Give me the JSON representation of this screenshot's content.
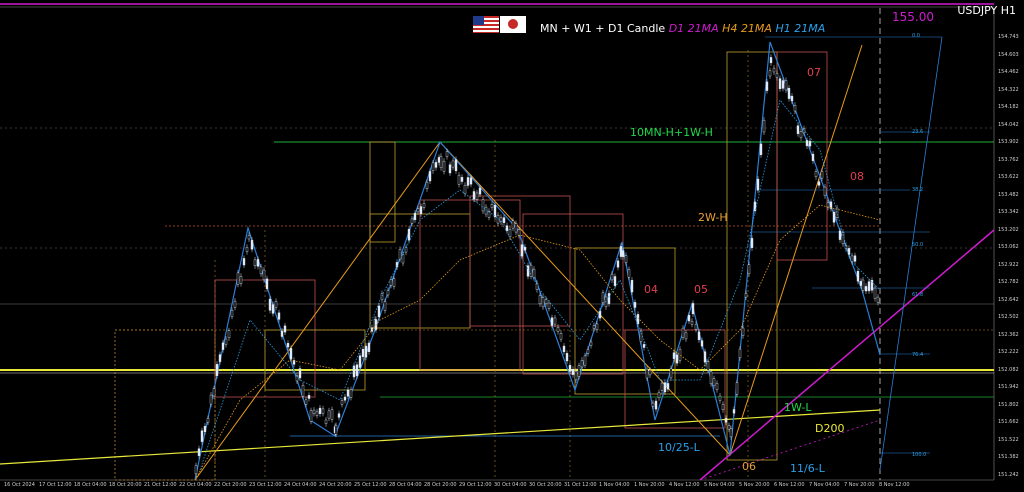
{
  "header": {
    "prefix": "MN + W1 + D1 Candle",
    "d1_ma": "D1 21MA",
    "h4_ma": "H4 21MA",
    "h1_ma": "H1 21MA"
  },
  "colors": {
    "d1_ma": "#d01bd0",
    "h4_ma": "#e89a1c",
    "h1_ma": "#2aa0e8",
    "candle": "#dfe9f7",
    "wave": "#2a7fd8",
    "level_green": "#1fae3a",
    "yellow_line": "#e8e83a",
    "magenta_line": "#d01bd0"
  },
  "symbol": "USDJPY H1",
  "price_level": "155.00",
  "labels": {
    "level_mn": "10MN-H+1W-H",
    "level_2w": "2W-H",
    "wave_04": "04",
    "wave_05": "05",
    "wave_06": "06",
    "wave_07": "07",
    "wave_08": "08",
    "level_1w": "1W-L",
    "d200": "D200",
    "low_1025": "10/25-L",
    "low_116": "11/6-L"
  },
  "fib_labels": [
    "0.0",
    "23.6",
    "38.2",
    "50.0",
    "61.8",
    "76.4",
    "100.0"
  ],
  "y_axis": [
    "154.743",
    "154.603",
    "154.462",
    "154.322",
    "154.182",
    "154.042",
    "153.902",
    "153.762",
    "153.622",
    "153.482",
    "153.342",
    "153.202",
    "153.062",
    "152.922",
    "152.782",
    "152.642",
    "152.502",
    "152.362",
    "152.222",
    "152.082",
    "151.942",
    "151.802",
    "151.662",
    "151.522",
    "151.382",
    "151.242"
  ],
  "x_axis": [
    "16 Oct 2024",
    "17 Oct 12:00",
    "18 Oct 04:00",
    "18 Oct 20:00",
    "21 Oct 12:00",
    "22 Oct 04:00",
    "22 Oct 20:00",
    "23 Oct 12:00",
    "24 Oct 04:00",
    "24 Oct 20:00",
    "25 Oct 12:00",
    "28 Oct 04:00",
    "28 Oct 20:00",
    "29 Oct 12:00",
    "30 Oct 04:00",
    "30 Oct 20:00",
    "31 Oct 12:00",
    "1 Nov 04:00",
    "1 Nov 20:00",
    "4 Nov 12:00",
    "5 Nov 04:00",
    "5 Nov 20:00",
    "6 Nov 12:00",
    "7 Nov 04:00",
    "7 Nov 20:00",
    "8 Nov 12:00"
  ]
}
